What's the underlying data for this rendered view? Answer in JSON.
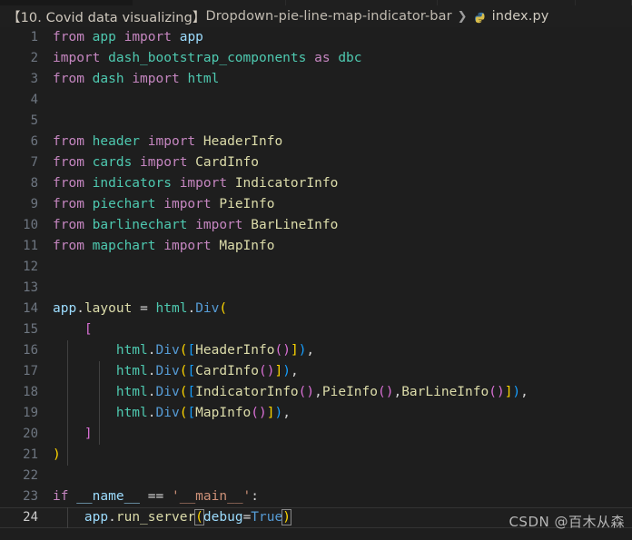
{
  "window": {
    "app": "Visual Studio Code",
    "background_color": "#1e1e1e"
  },
  "tab_strip": {
    "stub_widths": [
      288,
      332,
      328,
      300,
      120
    ]
  },
  "breadcrumb": {
    "project": "【10. Covid data visualizing】",
    "folder": "Dropdown-pie-line-map-indicator-bar",
    "separator": "❯",
    "file_icon": "python-icon",
    "file": "index.py"
  },
  "editor": {
    "language": "Python",
    "active_line": 24,
    "lines": [
      {
        "n": 1,
        "tokens": [
          {
            "t": "from",
            "c": "t-kw"
          },
          {
            "t": " ",
            "c": "t-op"
          },
          {
            "t": "app",
            "c": "t-mod"
          },
          {
            "t": " ",
            "c": "t-op"
          },
          {
            "t": "import",
            "c": "t-kw"
          },
          {
            "t": " ",
            "c": "t-op"
          },
          {
            "t": "app",
            "c": "t-var"
          }
        ]
      },
      {
        "n": 2,
        "tokens": [
          {
            "t": "import",
            "c": "t-kw"
          },
          {
            "t": " ",
            "c": "t-op"
          },
          {
            "t": "dash_bootstrap_components",
            "c": "t-mod"
          },
          {
            "t": " ",
            "c": "t-op"
          },
          {
            "t": "as",
            "c": "t-kw"
          },
          {
            "t": " ",
            "c": "t-op"
          },
          {
            "t": "dbc",
            "c": "t-dbc"
          }
        ]
      },
      {
        "n": 3,
        "tokens": [
          {
            "t": "from",
            "c": "t-kw"
          },
          {
            "t": " ",
            "c": "t-op"
          },
          {
            "t": "dash",
            "c": "t-mod"
          },
          {
            "t": " ",
            "c": "t-op"
          },
          {
            "t": "import",
            "c": "t-kw"
          },
          {
            "t": " ",
            "c": "t-op"
          },
          {
            "t": "html",
            "c": "t-mod"
          }
        ]
      },
      {
        "n": 4,
        "tokens": []
      },
      {
        "n": 5,
        "tokens": []
      },
      {
        "n": 6,
        "tokens": [
          {
            "t": "from",
            "c": "t-kw"
          },
          {
            "t": " ",
            "c": "t-op"
          },
          {
            "t": "header",
            "c": "t-mod"
          },
          {
            "t": " ",
            "c": "t-op"
          },
          {
            "t": "import",
            "c": "t-kw"
          },
          {
            "t": " ",
            "c": "t-op"
          },
          {
            "t": "HeaderInfo",
            "c": "t-cls"
          }
        ]
      },
      {
        "n": 7,
        "tokens": [
          {
            "t": "from",
            "c": "t-kw"
          },
          {
            "t": " ",
            "c": "t-op"
          },
          {
            "t": "cards",
            "c": "t-mod"
          },
          {
            "t": " ",
            "c": "t-op"
          },
          {
            "t": "import",
            "c": "t-kw"
          },
          {
            "t": " ",
            "c": "t-op"
          },
          {
            "t": "CardInfo",
            "c": "t-cls"
          }
        ]
      },
      {
        "n": 8,
        "tokens": [
          {
            "t": "from",
            "c": "t-kw"
          },
          {
            "t": " ",
            "c": "t-op"
          },
          {
            "t": "indicators",
            "c": "t-mod"
          },
          {
            "t": " ",
            "c": "t-op"
          },
          {
            "t": "import",
            "c": "t-kw"
          },
          {
            "t": " ",
            "c": "t-op"
          },
          {
            "t": "IndicatorInfo",
            "c": "t-cls"
          }
        ]
      },
      {
        "n": 9,
        "tokens": [
          {
            "t": "from",
            "c": "t-kw"
          },
          {
            "t": " ",
            "c": "t-op"
          },
          {
            "t": "piechart",
            "c": "t-mod"
          },
          {
            "t": " ",
            "c": "t-op"
          },
          {
            "t": "import",
            "c": "t-kw"
          },
          {
            "t": " ",
            "c": "t-op"
          },
          {
            "t": "PieInfo",
            "c": "t-cls"
          }
        ]
      },
      {
        "n": 10,
        "tokens": [
          {
            "t": "from",
            "c": "t-kw"
          },
          {
            "t": " ",
            "c": "t-op"
          },
          {
            "t": "barlinechart",
            "c": "t-mod"
          },
          {
            "t": " ",
            "c": "t-op"
          },
          {
            "t": "import",
            "c": "t-kw"
          },
          {
            "t": " ",
            "c": "t-op"
          },
          {
            "t": "BarLineInfo",
            "c": "t-cls"
          }
        ]
      },
      {
        "n": 11,
        "tokens": [
          {
            "t": "from",
            "c": "t-kw"
          },
          {
            "t": " ",
            "c": "t-op"
          },
          {
            "t": "mapchart",
            "c": "t-mod"
          },
          {
            "t": " ",
            "c": "t-op"
          },
          {
            "t": "import",
            "c": "t-kw"
          },
          {
            "t": " ",
            "c": "t-op"
          },
          {
            "t": "MapInfo",
            "c": "t-cls"
          }
        ]
      },
      {
        "n": 12,
        "tokens": []
      },
      {
        "n": 13,
        "tokens": []
      },
      {
        "n": 14,
        "tokens": [
          {
            "t": "app",
            "c": "t-var"
          },
          {
            "t": ".",
            "c": "dot"
          },
          {
            "t": "layout",
            "c": "t-cls"
          },
          {
            "t": " ",
            "c": "t-op"
          },
          {
            "t": "=",
            "c": "t-op"
          },
          {
            "t": " ",
            "c": "t-op"
          },
          {
            "t": "html",
            "c": "t-mod"
          },
          {
            "t": ".",
            "c": "dot"
          },
          {
            "t": "Div",
            "c": "t-const"
          },
          {
            "t": "(",
            "c": "b-yellow"
          }
        ]
      },
      {
        "n": 15,
        "tokens": [
          {
            "t": "    ",
            "c": "t-op"
          },
          {
            "t": "[",
            "c": "b-pink"
          }
        ]
      },
      {
        "n": 16,
        "tokens": [
          {
            "t": "        ",
            "c": "t-op"
          },
          {
            "t": "html",
            "c": "t-mod"
          },
          {
            "t": ".",
            "c": "dot"
          },
          {
            "t": "Div",
            "c": "t-const"
          },
          {
            "t": "(",
            "c": "b-yellow"
          },
          {
            "t": "[",
            "c": "b-blue"
          },
          {
            "t": "HeaderInfo",
            "c": "t-cls"
          },
          {
            "t": "()",
            "c": "b-pink"
          },
          {
            "t": "]",
            "c": "b-yellow"
          },
          {
            "t": ")",
            "c": "b-blue"
          },
          {
            "t": ",",
            "c": "t-op"
          }
        ]
      },
      {
        "n": 17,
        "tokens": [
          {
            "t": "        ",
            "c": "t-op"
          },
          {
            "t": "html",
            "c": "t-mod"
          },
          {
            "t": ".",
            "c": "dot"
          },
          {
            "t": "Div",
            "c": "t-const"
          },
          {
            "t": "(",
            "c": "b-yellow"
          },
          {
            "t": "[",
            "c": "b-blue"
          },
          {
            "t": "CardInfo",
            "c": "t-cls"
          },
          {
            "t": "()",
            "c": "b-pink"
          },
          {
            "t": "]",
            "c": "b-yellow"
          },
          {
            "t": ")",
            "c": "b-blue"
          },
          {
            "t": ",",
            "c": "t-op"
          }
        ]
      },
      {
        "n": 18,
        "tokens": [
          {
            "t": "        ",
            "c": "t-op"
          },
          {
            "t": "html",
            "c": "t-mod"
          },
          {
            "t": ".",
            "c": "dot"
          },
          {
            "t": "Div",
            "c": "t-const"
          },
          {
            "t": "(",
            "c": "b-yellow"
          },
          {
            "t": "[",
            "c": "b-blue"
          },
          {
            "t": "IndicatorInfo",
            "c": "t-cls"
          },
          {
            "t": "()",
            "c": "b-pink"
          },
          {
            "t": ",",
            "c": "t-op"
          },
          {
            "t": "PieInfo",
            "c": "t-cls"
          },
          {
            "t": "()",
            "c": "b-pink"
          },
          {
            "t": ",",
            "c": "t-op"
          },
          {
            "t": "BarLineInfo",
            "c": "t-cls"
          },
          {
            "t": "()",
            "c": "b-pink"
          },
          {
            "t": "]",
            "c": "b-yellow"
          },
          {
            "t": ")",
            "c": "b-blue"
          },
          {
            "t": ",",
            "c": "t-op"
          }
        ]
      },
      {
        "n": 19,
        "tokens": [
          {
            "t": "        ",
            "c": "t-op"
          },
          {
            "t": "html",
            "c": "t-mod"
          },
          {
            "t": ".",
            "c": "dot"
          },
          {
            "t": "Div",
            "c": "t-const"
          },
          {
            "t": "(",
            "c": "b-yellow"
          },
          {
            "t": "[",
            "c": "b-blue"
          },
          {
            "t": "MapInfo",
            "c": "t-cls"
          },
          {
            "t": "()",
            "c": "b-pink"
          },
          {
            "t": "]",
            "c": "b-yellow"
          },
          {
            "t": ")",
            "c": "b-blue"
          },
          {
            "t": ",",
            "c": "t-op"
          }
        ]
      },
      {
        "n": 20,
        "tokens": [
          {
            "t": "    ",
            "c": "t-op"
          },
          {
            "t": "]",
            "c": "b-pink"
          }
        ]
      },
      {
        "n": 21,
        "tokens": [
          {
            "t": ")",
            "c": "b-yellow"
          }
        ]
      },
      {
        "n": 22,
        "tokens": []
      },
      {
        "n": 23,
        "tokens": [
          {
            "t": "if",
            "c": "t-kw"
          },
          {
            "t": " ",
            "c": "t-op"
          },
          {
            "t": "__name__",
            "c": "t-var"
          },
          {
            "t": " ",
            "c": "t-op"
          },
          {
            "t": "==",
            "c": "t-op"
          },
          {
            "t": " ",
            "c": "t-op"
          },
          {
            "t": "'__main__'",
            "c": "t-str"
          },
          {
            "t": ":",
            "c": "t-op"
          }
        ]
      },
      {
        "n": 24,
        "tokens": [
          {
            "t": "    ",
            "c": "t-op"
          },
          {
            "t": "app",
            "c": "t-var"
          },
          {
            "t": ".",
            "c": "dot"
          },
          {
            "t": "run_server",
            "c": "t-cls"
          },
          {
            "t": "(",
            "c": "b-yellow bracket-match"
          },
          {
            "t": "debug",
            "c": "t-var"
          },
          {
            "t": "=",
            "c": "t-op"
          },
          {
            "t": "True",
            "c": "t-const"
          },
          {
            "t": ")",
            "c": "b-yellow bracket-match"
          }
        ]
      }
    ]
  },
  "watermark": {
    "text": "CSDN @百木从森"
  }
}
